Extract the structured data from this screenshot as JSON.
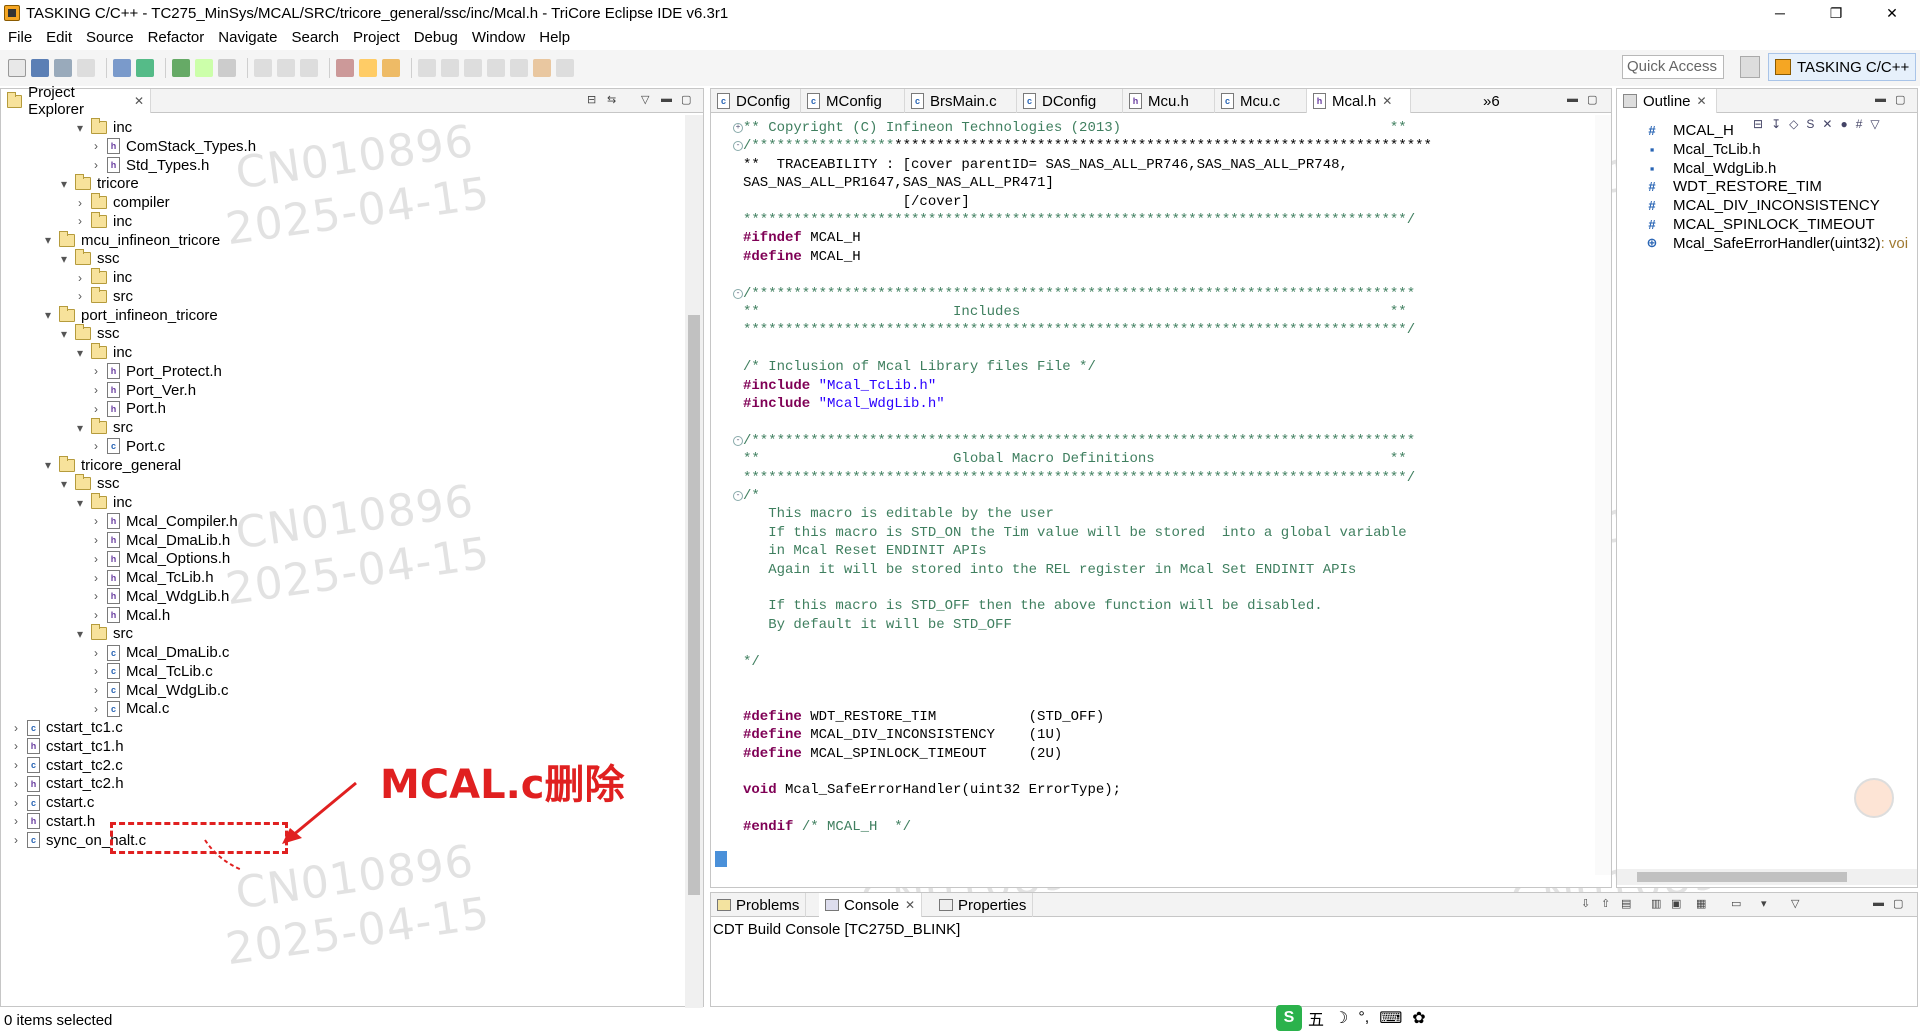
{
  "window": {
    "title": "TASKING C/C++ - TC275_MinSys/MCAL/SRC/tricore_general/ssc/inc/Mcal.h - TriCore Eclipse IDE v6.3r1",
    "minimize": "─",
    "restore": "❐",
    "close": "✕"
  },
  "menu": [
    "File",
    "Edit",
    "Source",
    "Refactor",
    "Navigate",
    "Search",
    "Project",
    "Debug",
    "Window",
    "Help"
  ],
  "toolbar": {
    "quick_access_placeholder": "Quick Access",
    "perspective_label": "TASKING C/C++"
  },
  "project_explorer": {
    "tab_label": "Project Explorer",
    "tree": [
      {
        "label": "inc",
        "depth": 5,
        "type": "folder",
        "expanded": true,
        "chev": "▾"
      },
      {
        "label": "ComStack_Types.h",
        "depth": 6,
        "type": "h",
        "chev": "›"
      },
      {
        "label": "Std_Types.h",
        "depth": 6,
        "type": "h",
        "chev": "›"
      },
      {
        "label": "tricore",
        "depth": 4,
        "type": "folder",
        "expanded": true,
        "chev": "▾"
      },
      {
        "label": "compiler",
        "depth": 5,
        "type": "folder",
        "chev": "›"
      },
      {
        "label": "inc",
        "depth": 5,
        "type": "folder",
        "chev": "›"
      },
      {
        "label": "mcu_infineon_tricore",
        "depth": 3,
        "type": "folder",
        "expanded": true,
        "chev": "▾"
      },
      {
        "label": "ssc",
        "depth": 4,
        "type": "folder",
        "expanded": true,
        "chev": "▾"
      },
      {
        "label": "inc",
        "depth": 5,
        "type": "folder",
        "chev": "›"
      },
      {
        "label": "src",
        "depth": 5,
        "type": "folder",
        "chev": "›"
      },
      {
        "label": "port_infineon_tricore",
        "depth": 3,
        "type": "folder",
        "expanded": true,
        "chev": "▾"
      },
      {
        "label": "ssc",
        "depth": 4,
        "type": "folder",
        "expanded": true,
        "chev": "▾"
      },
      {
        "label": "inc",
        "depth": 5,
        "type": "folder",
        "expanded": true,
        "chev": "▾"
      },
      {
        "label": "Port_Protect.h",
        "depth": 6,
        "type": "h",
        "chev": "›"
      },
      {
        "label": "Port_Ver.h",
        "depth": 6,
        "type": "h",
        "chev": "›"
      },
      {
        "label": "Port.h",
        "depth": 6,
        "type": "h",
        "chev": "›"
      },
      {
        "label": "src",
        "depth": 5,
        "type": "folder",
        "expanded": true,
        "chev": "▾"
      },
      {
        "label": "Port.c",
        "depth": 6,
        "type": "c",
        "chev": "›"
      },
      {
        "label": "tricore_general",
        "depth": 3,
        "type": "folder",
        "expanded": true,
        "chev": "▾"
      },
      {
        "label": "ssc",
        "depth": 4,
        "type": "folder",
        "expanded": true,
        "chev": "▾"
      },
      {
        "label": "inc",
        "depth": 5,
        "type": "folder",
        "expanded": true,
        "chev": "▾"
      },
      {
        "label": "Mcal_Compiler.h",
        "depth": 6,
        "type": "h",
        "chev": "›"
      },
      {
        "label": "Mcal_DmaLib.h",
        "depth": 6,
        "type": "h",
        "chev": "›"
      },
      {
        "label": "Mcal_Options.h",
        "depth": 6,
        "type": "h",
        "chev": "›"
      },
      {
        "label": "Mcal_TcLib.h",
        "depth": 6,
        "type": "h",
        "chev": "›"
      },
      {
        "label": "Mcal_WdgLib.h",
        "depth": 6,
        "type": "h",
        "chev": "›"
      },
      {
        "label": "Mcal.h",
        "depth": 6,
        "type": "h",
        "chev": "›"
      },
      {
        "label": "src",
        "depth": 5,
        "type": "folder",
        "expanded": true,
        "chev": "▾"
      },
      {
        "label": "Mcal_DmaLib.c",
        "depth": 6,
        "type": "c",
        "chev": "›"
      },
      {
        "label": "Mcal_TcLib.c",
        "depth": 6,
        "type": "c",
        "chev": "›"
      },
      {
        "label": "Mcal_WdgLib.c",
        "depth": 6,
        "type": "c",
        "chev": "›"
      },
      {
        "label": "Mcal.c",
        "depth": 6,
        "type": "c",
        "chev": "›"
      },
      {
        "label": "cstart_tc1.c",
        "depth": 1,
        "type": "c",
        "chev": "›"
      },
      {
        "label": "cstart_tc1.h",
        "depth": 1,
        "type": "h",
        "chev": "›"
      },
      {
        "label": "cstart_tc2.c",
        "depth": 1,
        "type": "c",
        "chev": "›"
      },
      {
        "label": "cstart_tc2.h",
        "depth": 1,
        "type": "h",
        "chev": "›"
      },
      {
        "label": "cstart.c",
        "depth": 1,
        "type": "c",
        "chev": "›"
      },
      {
        "label": "cstart.h",
        "depth": 1,
        "type": "h",
        "chev": "›"
      },
      {
        "label": "sync_on_halt.c",
        "depth": 1,
        "type": "c",
        "chev": "›"
      }
    ]
  },
  "annotation": {
    "text": "MCAL.c删除"
  },
  "watermarks": [
    "CN010896",
    "2025-04-15"
  ],
  "editor": {
    "tabs": [
      {
        "label": "DConfig",
        "icon": "c"
      },
      {
        "label": "MConfig",
        "icon": "c"
      },
      {
        "label": "BrsMain.c",
        "icon": "c"
      },
      {
        "label": "DConfig",
        "icon": "c"
      },
      {
        "label": "Mcu.h",
        "icon": "h"
      },
      {
        "label": "Mcu.c",
        "icon": "c"
      },
      {
        "label": "Mcal.h",
        "icon": "h",
        "active": true
      }
    ],
    "overflow_label": "»6",
    "lines": [
      {
        "row": 0,
        "fold": "+",
        "parts": [
          {
            "t": "** Copyright (C) Infineon Technologies (2013)                                **",
            "c": "comment"
          }
        ]
      },
      {
        "row": 1,
        "fold": "-",
        "parts": [
          {
            "t": "/*****************",
            "c": "comment"
          },
          {
            "t": "****************************************************************",
            "c": "hl"
          }
        ]
      },
      {
        "row": 2,
        "parts": [
          {
            "t": "**  TRACEABILITY : [cover parentID= SAS_NAS_ALL_PR746,SAS_NAS_ALL_PR748,      ",
            "c": "hl"
          }
        ]
      },
      {
        "row": 3,
        "parts": [
          {
            "t": "SAS_NAS_ALL_PR1647,SAS_NAS_ALL_PR471]                                          ",
            "c": "hl"
          }
        ]
      },
      {
        "row": 4,
        "parts": [
          {
            "t": "                   [/cover]",
            "c": "hl"
          }
        ]
      },
      {
        "row": 5,
        "parts": [
          {
            "t": "*******************************************************************************/",
            "c": "comment"
          }
        ]
      },
      {
        "row": 6,
        "parts": [
          {
            "t": "#ifndef",
            "c": "kw"
          },
          {
            "t": " MCAL_H",
            "c": "plain"
          }
        ]
      },
      {
        "row": 7,
        "parts": [
          {
            "t": "#define",
            "c": "kw"
          },
          {
            "t": " MCAL_H",
            "c": "plain"
          }
        ]
      },
      {
        "row": 9,
        "fold": "-",
        "parts": [
          {
            "t": "/*******************************************************************************",
            "c": "comment"
          }
        ]
      },
      {
        "row": 10,
        "parts": [
          {
            "t": "**                       Includes                                            **",
            "c": "comment"
          }
        ]
      },
      {
        "row": 11,
        "parts": [
          {
            "t": "*******************************************************************************/",
            "c": "comment"
          }
        ]
      },
      {
        "row": 13,
        "parts": [
          {
            "t": "/* Inclusion of Mcal Library files File */",
            "c": "comment"
          }
        ]
      },
      {
        "row": 14,
        "parts": [
          {
            "t": "#include",
            "c": "kw"
          },
          {
            "t": " \"Mcal_TcLib.h\"",
            "c": "str"
          }
        ]
      },
      {
        "row": 15,
        "parts": [
          {
            "t": "#include",
            "c": "kw"
          },
          {
            "t": " \"Mcal_WdgLib.h\"",
            "c": "str"
          }
        ]
      },
      {
        "row": 17,
        "fold": "-",
        "parts": [
          {
            "t": "/*******************************************************************************",
            "c": "comment"
          }
        ]
      },
      {
        "row": 18,
        "parts": [
          {
            "t": "**                       Global Macro Definitions                            **",
            "c": "comment"
          }
        ]
      },
      {
        "row": 19,
        "parts": [
          {
            "t": "*******************************************************************************/",
            "c": "comment"
          }
        ]
      },
      {
        "row": 20,
        "fold": "-",
        "parts": [
          {
            "t": "/*",
            "c": "comment"
          }
        ]
      },
      {
        "row": 21,
        "parts": [
          {
            "t": "   This macro is editable by the user",
            "c": "comment"
          }
        ]
      },
      {
        "row": 22,
        "parts": [
          {
            "t": "   If this macro is STD_ON the Tim value will be stored  into a global variable",
            "c": "comment"
          }
        ]
      },
      {
        "row": 23,
        "parts": [
          {
            "t": "   in Mcal Reset ENDINIT APIs",
            "c": "comment"
          }
        ]
      },
      {
        "row": 24,
        "parts": [
          {
            "t": "   Again it will be stored into the REL register in Mcal Set ENDINIT APIs",
            "c": "comment"
          }
        ]
      },
      {
        "row": 26,
        "parts": [
          {
            "t": "   If this macro is STD_OFF then the above function will be disabled.",
            "c": "comment"
          }
        ]
      },
      {
        "row": 27,
        "parts": [
          {
            "t": "   By default it will be STD_OFF",
            "c": "comment"
          }
        ]
      },
      {
        "row": 29,
        "parts": [
          {
            "t": "*/",
            "c": "comment"
          }
        ]
      },
      {
        "row": 32,
        "parts": [
          {
            "t": "#define",
            "c": "kw"
          },
          {
            "t": " WDT_RESTORE_TIM           (STD_OFF)",
            "c": "plain"
          }
        ]
      },
      {
        "row": 33,
        "parts": [
          {
            "t": "#define",
            "c": "kw"
          },
          {
            "t": " MCAL_DIV_INCONSISTENCY    (1U)",
            "c": "plain"
          }
        ]
      },
      {
        "row": 34,
        "parts": [
          {
            "t": "#define",
            "c": "kw"
          },
          {
            "t": " MCAL_SPINLOCK_TIMEOUT     (2U)",
            "c": "plain"
          }
        ]
      },
      {
        "row": 36,
        "parts": [
          {
            "t": "void",
            "c": "kw"
          },
          {
            "t": " Mcal_SafeErrorHandler(uint32 ErrorType);",
            "c": "plain"
          }
        ]
      },
      {
        "row": 38,
        "parts": [
          {
            "t": "#endif",
            "c": "kw"
          },
          {
            "t": " /* MCAL_H  */",
            "c": "comment"
          }
        ]
      }
    ]
  },
  "outline": {
    "tab_label": "Outline",
    "items": [
      {
        "icon": "#",
        "label": "MCAL_H"
      },
      {
        "icon": "▪",
        "label": "Mcal_TcLib.h"
      },
      {
        "icon": "▪",
        "label": "Mcal_WdgLib.h"
      },
      {
        "icon": "#",
        "label": "WDT_RESTORE_TIM"
      },
      {
        "icon": "#",
        "label": "MCAL_DIV_INCONSISTENCY"
      },
      {
        "icon": "#",
        "label": "MCAL_SPINLOCK_TIMEOUT"
      },
      {
        "icon": "⊕",
        "label": "Mcal_SafeErrorHandler(uint32)",
        "ret": " : voi"
      }
    ]
  },
  "console": {
    "tabs": [
      "Problems",
      "Console",
      "Properties"
    ],
    "title": "CDT Build Console [TC275D_BLINK]"
  },
  "status": {
    "text": "0 items selected"
  },
  "ime": {
    "logo": "S",
    "mode": "五",
    "items": [
      "☽",
      "°,",
      "⌨",
      "✿"
    ]
  },
  "colors": {
    "selection": "#3399ff",
    "annotation": "#e02020",
    "keyword": "#7f0055",
    "comment": "#3f7f5f",
    "string": "#2a00ff"
  }
}
